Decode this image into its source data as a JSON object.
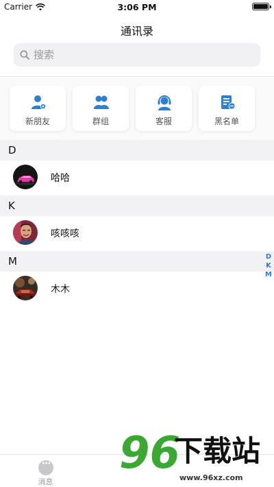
{
  "status_bar": {
    "carrier": "Carrier",
    "time": "3:06 PM",
    "battery_level": 1.0
  },
  "nav": {
    "title": "通讯录"
  },
  "search": {
    "placeholder": "搜索"
  },
  "shortcuts": [
    {
      "label": "新朋友",
      "icon": "person-add-icon"
    },
    {
      "label": "群组",
      "icon": "group-icon"
    },
    {
      "label": "客服",
      "icon": "headset-icon"
    },
    {
      "label": "黑名单",
      "icon": "blacklist-icon"
    }
  ],
  "sections": [
    {
      "letter": "D",
      "contacts": [
        {
          "name": "哈哈",
          "avatar": "car-photo"
        }
      ]
    },
    {
      "letter": "K",
      "contacts": [
        {
          "name": "咳咳咳",
          "avatar": "person-photo"
        }
      ]
    },
    {
      "letter": "M",
      "contacts": [
        {
          "name": "木木",
          "avatar": "night-street-photo"
        }
      ]
    }
  ],
  "index_letters": [
    "D",
    "K",
    "M"
  ],
  "tabs": [
    {
      "label": "消息",
      "icon": "chat-bubble-icon"
    }
  ],
  "watermark": {
    "brand": "96下载站",
    "url": "www.96xz.com"
  },
  "colors": {
    "accent": "#2f7fd0",
    "section_bg": "#f2f2f4",
    "search_bg": "#f0f0f2",
    "watermark_green": "#3aa832"
  }
}
